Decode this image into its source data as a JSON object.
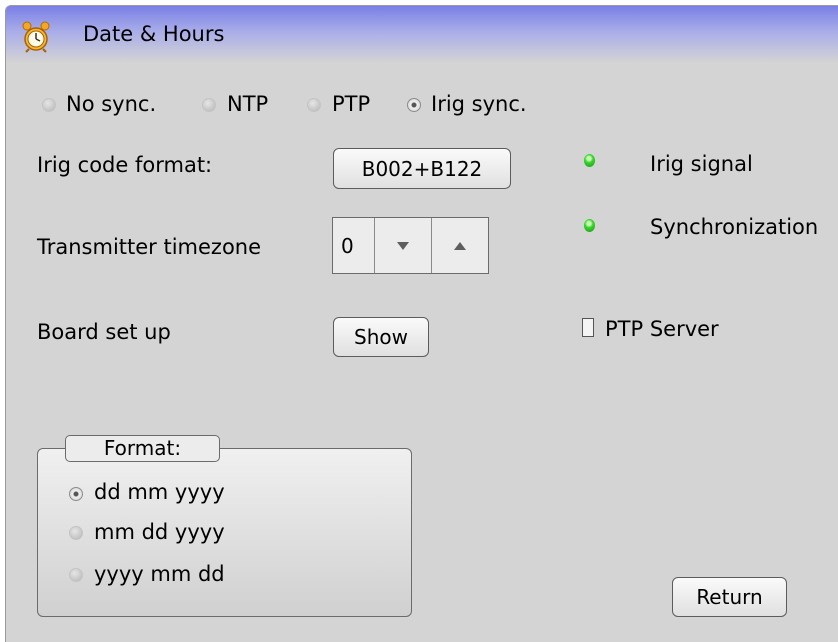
{
  "window": {
    "title": "Date & Hours",
    "icon": "alarm-clock-icon"
  },
  "sync": {
    "options": [
      "No sync.",
      "NTP",
      "PTP",
      "Irig sync."
    ],
    "selected": "Irig sync."
  },
  "irig": {
    "label": "Irig code format:",
    "value": "B002+B122"
  },
  "status": {
    "irig_signal": "Irig signal",
    "synchronization": "Synchronization",
    "led_color": "#2ecc23"
  },
  "timezone": {
    "label": "Transmitter timezone",
    "value": "0"
  },
  "board": {
    "label": "Board set up",
    "button": "Show"
  },
  "ptp_server": {
    "label": "PTP Server",
    "checked": false
  },
  "format": {
    "title": "Format:",
    "options": [
      "dd mm yyyy",
      "mm dd yyyy",
      "yyyy mm dd"
    ],
    "selected": "dd mm yyyy"
  },
  "actions": {
    "return": "Return"
  }
}
